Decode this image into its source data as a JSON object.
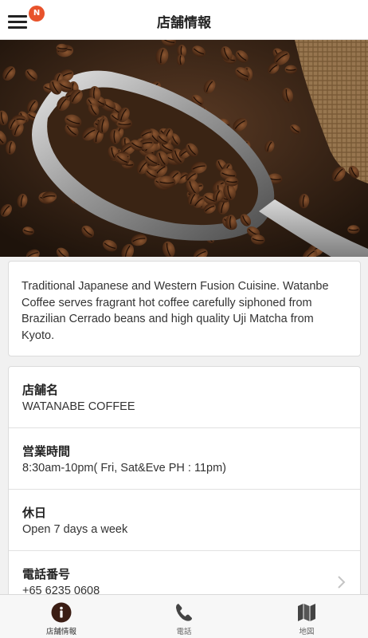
{
  "header": {
    "title": "店舗情報",
    "notification_badge": "N",
    "menu_icon": "hamburger-menu-icon"
  },
  "hero": {
    "image": "coffee-beans-scoop-photo"
  },
  "description": "Traditional Japanese and Western Fusion Cuisine. Watanbe Coffee serves fragrant hot coffee carefully siphoned from Brazilian Cerrado beans and high quality Uji Matcha from Kyoto.",
  "info": [
    {
      "label": "店舗名",
      "value": "WATANABE COFFEE"
    },
    {
      "label": "営業時間",
      "value": "8:30am-10pm( Fri, Sat&Eve PH : 11pm)"
    },
    {
      "label": "休日",
      "value": "Open 7 days a week"
    },
    {
      "label": "電話番号",
      "value": "+65 6235 0608"
    }
  ],
  "tabs": [
    {
      "label": "店舗情報",
      "icon": "info-icon",
      "active": true
    },
    {
      "label": "電話",
      "icon": "phone-icon",
      "active": false
    },
    {
      "label": "地図",
      "icon": "map-icon",
      "active": false
    }
  ],
  "colors": {
    "badge": "#e8532c",
    "active_tab_icon": "#3b1d14",
    "inactive_tab_icon": "#444444",
    "background": "#f1f1f1"
  }
}
